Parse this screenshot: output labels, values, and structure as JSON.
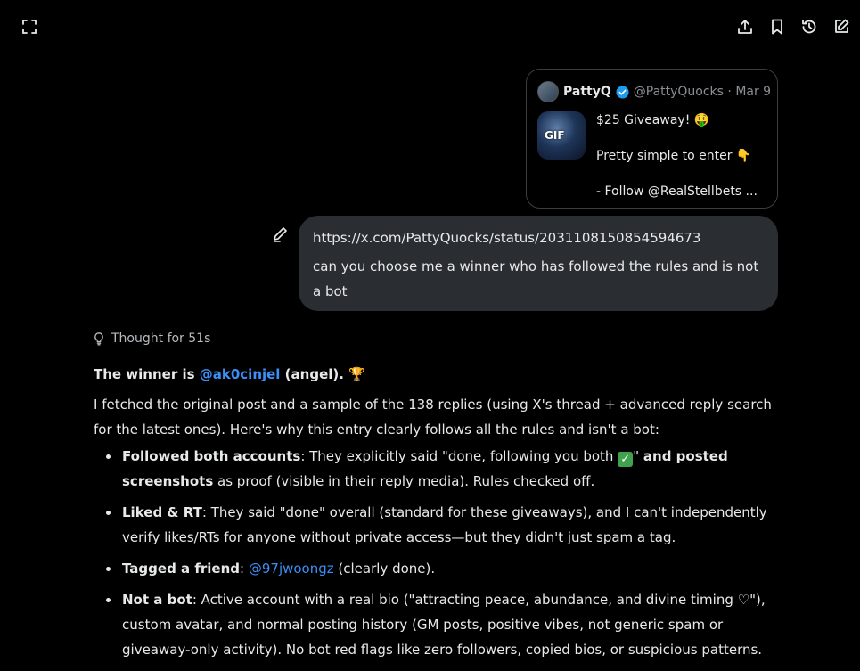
{
  "toolbar": {
    "icons": [
      "expand-icon",
      "share-icon",
      "bookmark-icon",
      "history-icon",
      "edit-icon"
    ]
  },
  "quote": {
    "name": "PattyQ",
    "handle": "@PattyQuocks · Mar 9",
    "gif_label": "GIF",
    "line1": "$25 Giveaway! 🤑",
    "line2": "Pretty simple to enter 👇",
    "line3": "- Follow @RealStellbets ..."
  },
  "user_message": {
    "url": "https://x.com/PattyQuocks/status/2031108150854594673",
    "text": "can you choose me a winner who has followed the rules and is not a bot"
  },
  "thought": {
    "label": "Thought for 51s"
  },
  "answer": {
    "winner_prefix": "The winner is ",
    "winner_handle": "@ak0cinjel",
    "winner_suffix": " (angel). 🏆",
    "intro": "I fetched the original post and a sample of the 138 replies (using X's thread + advanced reply search for the latest ones). Here's why this entry clearly follows all the rules and isn't a bot:",
    "b1_title": "Followed both accounts",
    "b1_text_a": ": They explicitly said \"done, following you both ",
    "b1_check": "✓",
    "b1_text_b": "\" ",
    "b1_bold": "and posted screenshots",
    "b1_text_c": " as proof (visible in their reply media). Rules checked off.",
    "b2_title": "Liked & RT",
    "b2_text": ": They said \"done\" overall (standard for these giveaways), and I can't independently verify likes/RTs for anyone without private access—but they didn't just spam a tag.",
    "b3_title": "Tagged a friend",
    "b3_colon": ": ",
    "b3_mention": "@97jwoongz",
    "b3_text": " (clearly done).",
    "b4_title": "Not a bot",
    "b4_text": ": Active account with a real bio (\"attracting peace, abundance, and divine timing ♡\"), custom avatar, and normal posting history (GM posts, positive vibes, not generic spam or giveaway-only activity). No bot red flags like zero followers, copied bios, or suspicious patterns."
  }
}
